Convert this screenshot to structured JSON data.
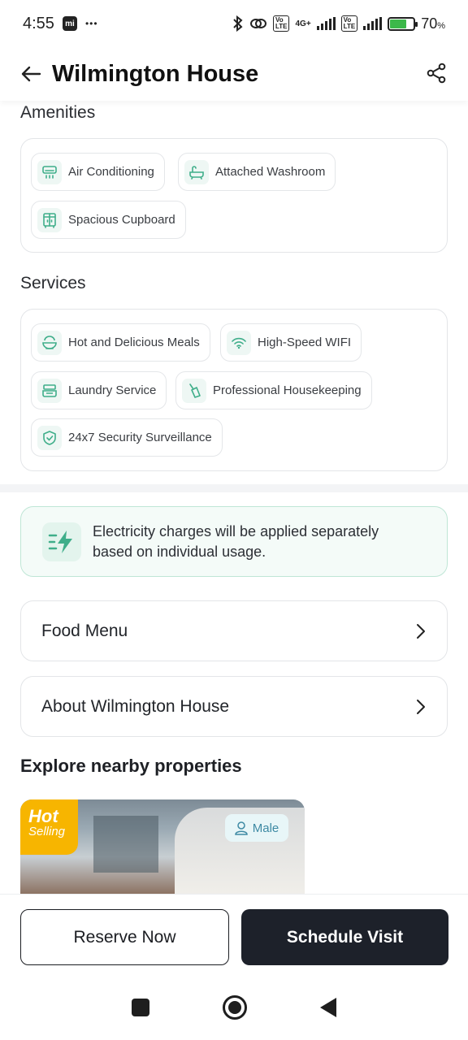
{
  "status_bar": {
    "time": "4:55",
    "dots": "•••",
    "network": "4G+",
    "volte": "Vo LTE",
    "battery_percent": "70",
    "battery_unit": "%",
    "battery_level": 0.7
  },
  "header": {
    "title": "Wilmington House"
  },
  "amenities": {
    "title": "Amenities",
    "items": [
      {
        "label": "Air Conditioning",
        "icon": "air-conditioner-icon"
      },
      {
        "label": "Attached Washroom",
        "icon": "bathtub-icon"
      },
      {
        "label": "Spacious Cupboard",
        "icon": "cupboard-icon"
      }
    ]
  },
  "services": {
    "title": "Services",
    "items": [
      {
        "label": "Hot and Delicious Meals",
        "icon": "meal-bowl-icon"
      },
      {
        "label": "High-Speed WIFI",
        "icon": "wifi-icon"
      },
      {
        "label": "Laundry Service",
        "icon": "laundry-icon"
      },
      {
        "label": "Professional Housekeeping",
        "icon": "broom-icon"
      },
      {
        "label": "24x7 Security Surveillance",
        "icon": "shield-icon"
      }
    ]
  },
  "notice": {
    "text_line1": "Electricity charges will be applied separately",
    "text_line2": "based on individual usage.",
    "icon": "electricity-icon"
  },
  "links": {
    "food_menu": "Food Menu",
    "about": "About Wilmington House"
  },
  "nearby": {
    "title": "Explore nearby properties",
    "card": {
      "badge_line1": "Hot",
      "badge_line2": "Selling",
      "gender": "Male"
    }
  },
  "actions": {
    "reserve": "Reserve Now",
    "schedule": "Schedule Visit"
  },
  "colors": {
    "accent_green": "#3fae8a",
    "dark_button": "#1d212a",
    "badge_yellow": "#f7b500"
  }
}
